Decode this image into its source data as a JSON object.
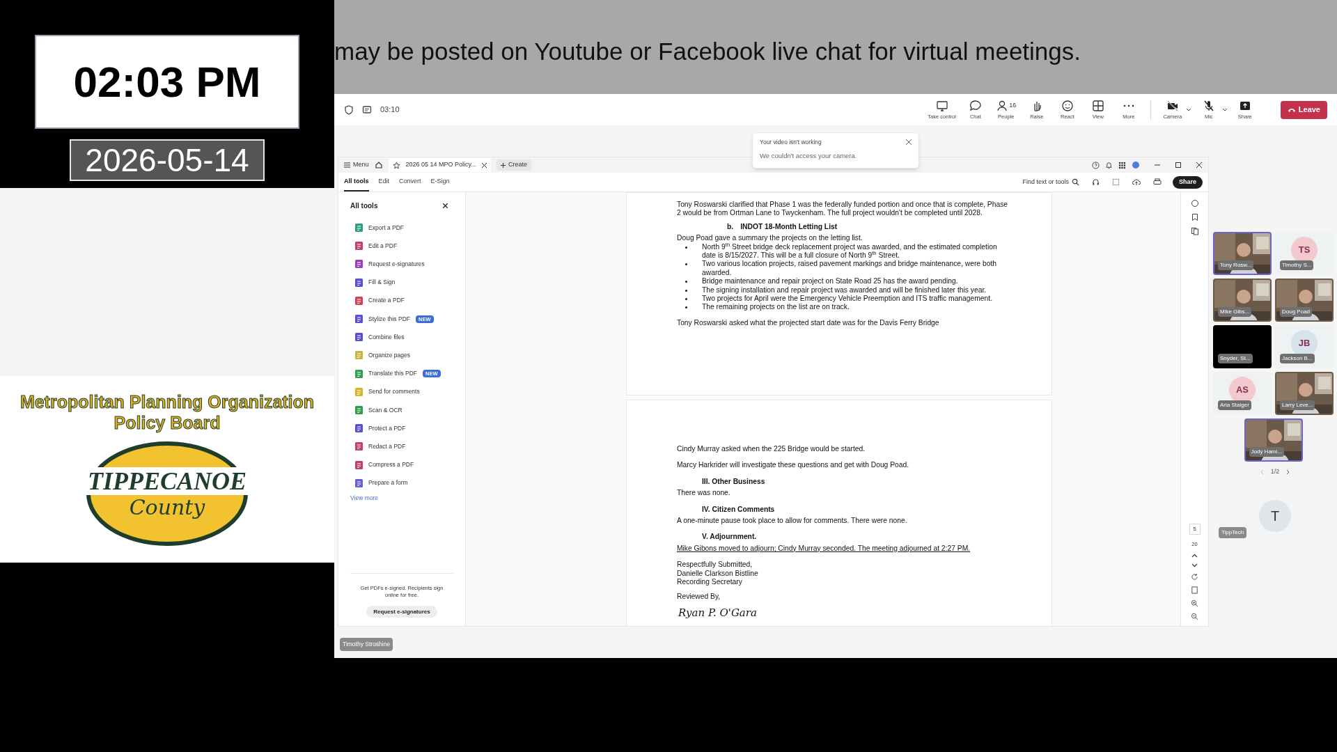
{
  "clock": {
    "time": "02:03 PM",
    "date": "2026-05-14"
  },
  "org": {
    "title": "Metropolitan Planning Organization Policy Board",
    "logo_top": "TIPPECANOE",
    "logo_bottom": "County"
  },
  "banner": {
    "text": "may be posted on Youtube or Facebook live chat for virtual meetings."
  },
  "meeting": {
    "duration": "03:10",
    "toolbar": [
      {
        "kind": "share-screen",
        "label": "Take control"
      },
      {
        "kind": "chat",
        "label": "Chat"
      },
      {
        "kind": "people",
        "label": "People",
        "count": "16"
      },
      {
        "kind": "raise",
        "label": "Raise"
      },
      {
        "kind": "react",
        "label": "React"
      },
      {
        "kind": "view",
        "label": "View"
      },
      {
        "kind": "more",
        "label": "More"
      },
      {
        "kind": "camera",
        "label": "Camera"
      },
      {
        "kind": "mic",
        "label": "Mic"
      },
      {
        "kind": "share",
        "label": "Share"
      }
    ],
    "leave": "Leave"
  },
  "toast": {
    "title": "Your video isn't working",
    "message": "We couldn't access your camera."
  },
  "acrobat": {
    "menu": "Menu",
    "doc_tab": "2026 05 14 MPO Policy...",
    "create": "Create",
    "tabs": [
      {
        "label": "All tools",
        "selected": true
      },
      {
        "label": "Edit",
        "selected": false
      },
      {
        "label": "Convert",
        "selected": false
      },
      {
        "label": "E-Sign",
        "selected": false
      }
    ],
    "find": "Find text or tools",
    "share": "Share",
    "panel": {
      "title": "All tools",
      "tools": [
        {
          "label": "Export a PDF",
          "color": "#2e9e83"
        },
        {
          "label": "Edit a PDF",
          "color": "#c2416b"
        },
        {
          "label": "Request e-signatures",
          "color": "#9a3fb5"
        },
        {
          "label": "Fill & Sign",
          "color": "#5a4fcf"
        },
        {
          "label": "Create a PDF",
          "color": "#d0464f"
        },
        {
          "label": "Stylize this PDF",
          "color": "#5a4fcf",
          "badge": "NEW"
        },
        {
          "label": "Combine files",
          "color": "#5a4fcf"
        },
        {
          "label": "Organize pages",
          "color": "#c9b53a"
        },
        {
          "label": "Translate this PDF",
          "color": "#2e9e4f",
          "badge": "NEW"
        },
        {
          "label": "Send for comments",
          "color": "#d8b52a"
        },
        {
          "label": "Scan & OCR",
          "color": "#2e9e4f"
        },
        {
          "label": "Protect a PDF",
          "color": "#5a4fcf"
        },
        {
          "label": "Redact a PDF",
          "color": "#c2416b"
        },
        {
          "label": "Compress a PDF",
          "color": "#c2416b"
        },
        {
          "label": "Prepare a form",
          "color": "#6a5fcf"
        }
      ],
      "view_more": "View more",
      "promo": "Get PDFs e-signed. Recipients sign online for free.",
      "promo_button": "Request e-signatures"
    },
    "page_nav": {
      "current": "5",
      "total": "20"
    }
  },
  "document": {
    "pages": [
      {
        "blocks": [
          {
            "kind": "para",
            "text": "Tony Roswarski clarified that Phase 1 was the federally funded portion and once that is complete, Phase 2 would be from Ortman Lane to Twyckenham. The full project wouldn't be completed until 2028."
          },
          {
            "kind": "subheading",
            "label": "b.",
            "text": "INDOT 18-Month Letting List"
          },
          {
            "kind": "para",
            "text": "Doug Poad gave a summary the projects on the letting list."
          },
          {
            "kind": "bullets",
            "items": [
              "North 9$^{th}$ Street bridge deck replacement project was awarded, and the estimated completion date is 8/15/2027. This will be a full closure of North 9$^{th}$ Street.",
              "Two various location projects, raised pavement markings and bridge maintenance, were both awarded.",
              "Bridge maintenance and repair project on State Road 25 has the award pending.",
              "The signing installation and repair project was awarded and will be finished later this year.",
              "Two projects for April were the Emergency Vehicle Preemption and ITS traffic management.",
              "The remaining projects on the list are on track."
            ]
          },
          {
            "kind": "para",
            "text": "Tony Roswarski asked what the projected start date was for the Davis Ferry Bridge"
          }
        ]
      },
      {
        "blocks": [
          {
            "kind": "para",
            "text": "Cindy Murray asked when the 225 Bridge would be started."
          },
          {
            "kind": "para",
            "text": "Marcy Harkrider will investigate these questions and get with Doug Poad."
          },
          {
            "kind": "heading",
            "text": "III. Other Business"
          },
          {
            "kind": "para",
            "text": "There was none."
          },
          {
            "kind": "heading",
            "text": "IV. Citizen Comments"
          },
          {
            "kind": "para",
            "text": "A one-minute pause took place to allow for comments.  There were none."
          },
          {
            "kind": "heading",
            "text": "V.  Adjournment."
          },
          {
            "kind": "underline",
            "text": "Mike Gibons moved to adjourn; Cindy Murray seconded. The meeting adjourned at 2:27 PM."
          },
          {
            "kind": "lines",
            "items": [
              "Respectfully Submitted,",
              "Danielle Clarkson Bistline",
              "Recording Secretary"
            ]
          },
          {
            "kind": "para",
            "text": "Reviewed By,"
          },
          {
            "kind": "signature",
            "text": "Ryan P. O'Gara"
          }
        ]
      }
    ]
  },
  "participants": [
    {
      "name": "Tony Rosw...",
      "kind": "video",
      "highlighted": true
    },
    {
      "name": "Timothy S...",
      "kind": "initials",
      "initials": "TS",
      "color": "#f3c9d0",
      "highlighted": false
    },
    {
      "name": "Mike Gibs...",
      "kind": "video",
      "highlighted": false
    },
    {
      "name": "Doug Poad",
      "kind": "video",
      "highlighted": false
    },
    {
      "name": "Snyder, St...",
      "kind": "dark",
      "highlighted": false
    },
    {
      "name": "Jackson B...",
      "kind": "initials",
      "initials": "JB",
      "color": "#d7e3ea",
      "highlighted": false
    },
    {
      "name": "Aria Staiger",
      "kind": "initials",
      "initials": "AS",
      "color": "#f3c9d0",
      "highlighted": false
    },
    {
      "name": "Larry Leve...",
      "kind": "video",
      "highlighted": false
    },
    {
      "name": "Jody Hami...",
      "kind": "video",
      "highlighted": true
    }
  ],
  "pager": "1/2",
  "self": {
    "initial": "T",
    "name": "TippTech"
  },
  "presenter": "Timothy Stroshine"
}
